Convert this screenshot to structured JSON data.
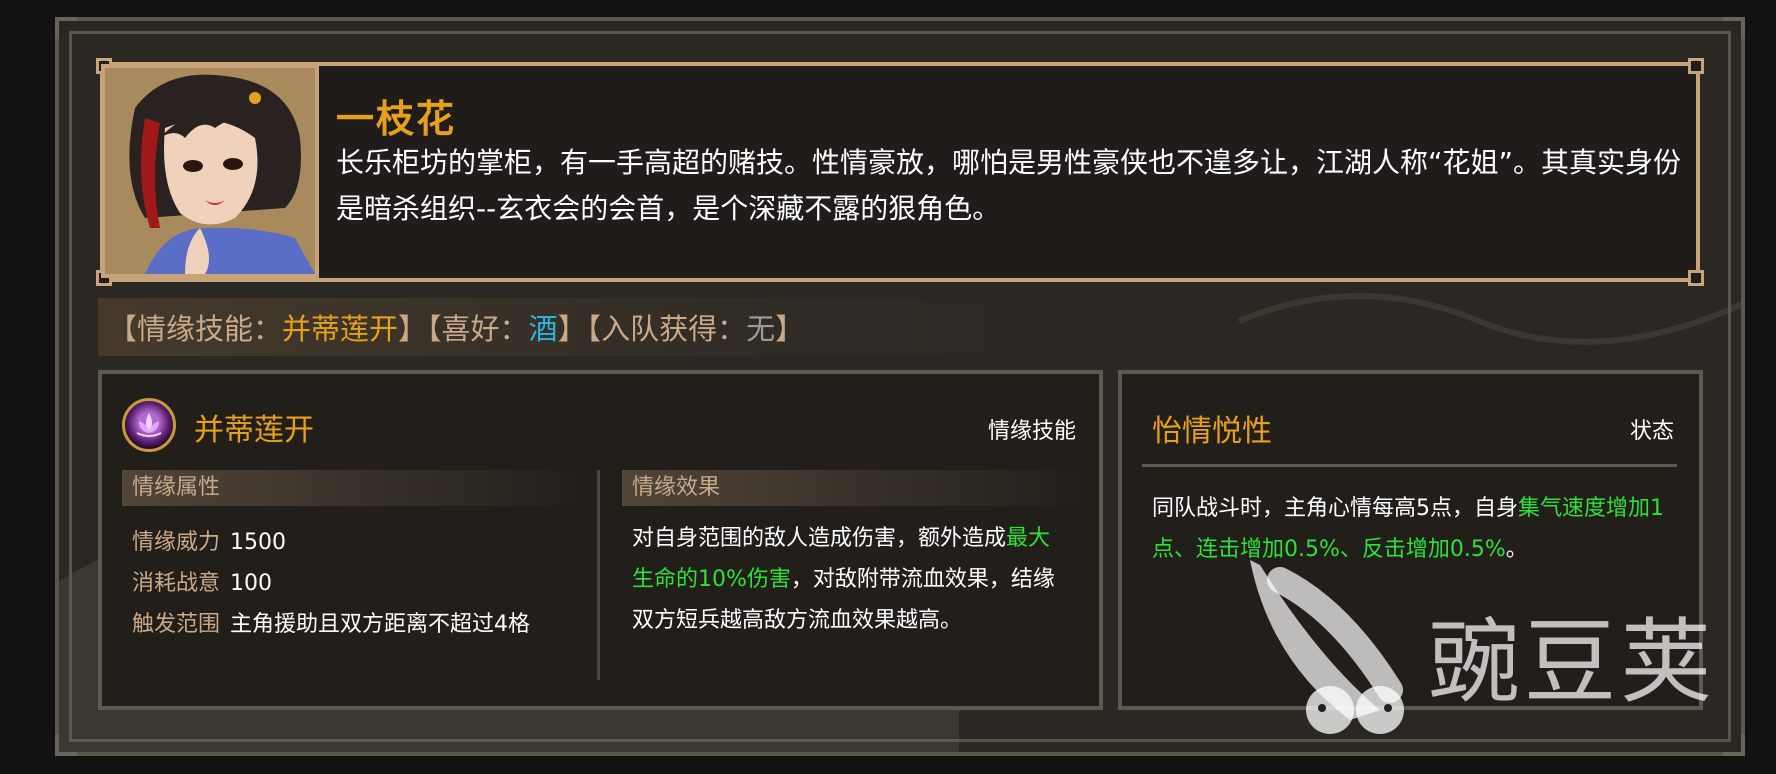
{
  "character": {
    "name": "一枝花",
    "description": "长乐柜坊的掌柜，有一手高超的赌技。性情豪放，哪怕是男性豪侠也不遑多让，江湖人称“花姐”。其真实身份是暗杀组织--玄衣会的会首，是个深藏不露的狠角色。"
  },
  "info": {
    "open1": "【情缘技能：",
    "skill": "并蒂莲开",
    "close1": "】",
    "open2": "【喜好：",
    "hobby": "酒",
    "close2": "】",
    "open3": "【入队获得：",
    "gain": "无",
    "close3": "】"
  },
  "skill_panel": {
    "name": "并蒂莲开",
    "type": "情缘技能",
    "icon": "lotus-icon",
    "attr_header": "情缘属性",
    "effect_header": "情缘效果",
    "attrs": [
      {
        "key": "情缘威力",
        "value": "1500"
      },
      {
        "key": "消耗战意",
        "value": "100"
      },
      {
        "key": "触发范围",
        "value": "主角援助且双方距离不超过4格"
      }
    ],
    "effect": {
      "part1": "对自身范围的敌人造成伤害，额外造成",
      "highlight": "最大生命的10%伤害",
      "part2": "，对敌附带流血效果，结缘双方短兵越高敌方流血效果越高。"
    }
  },
  "state_panel": {
    "name": "怡情悦性",
    "type": "状态",
    "part1": "同队战斗时，主角心情每高5点，自身",
    "highlight": "集气速度增加1点、连击增加0.5%、反击增加0.5%",
    "part2": "。"
  },
  "watermark": {
    "text": "豌豆荚",
    "icon": "pea-pod-logo"
  },
  "colors": {
    "gold": "#e6a01c",
    "cyan": "#28b6e0",
    "green": "#2fe03a",
    "border": "#c8a27a"
  }
}
